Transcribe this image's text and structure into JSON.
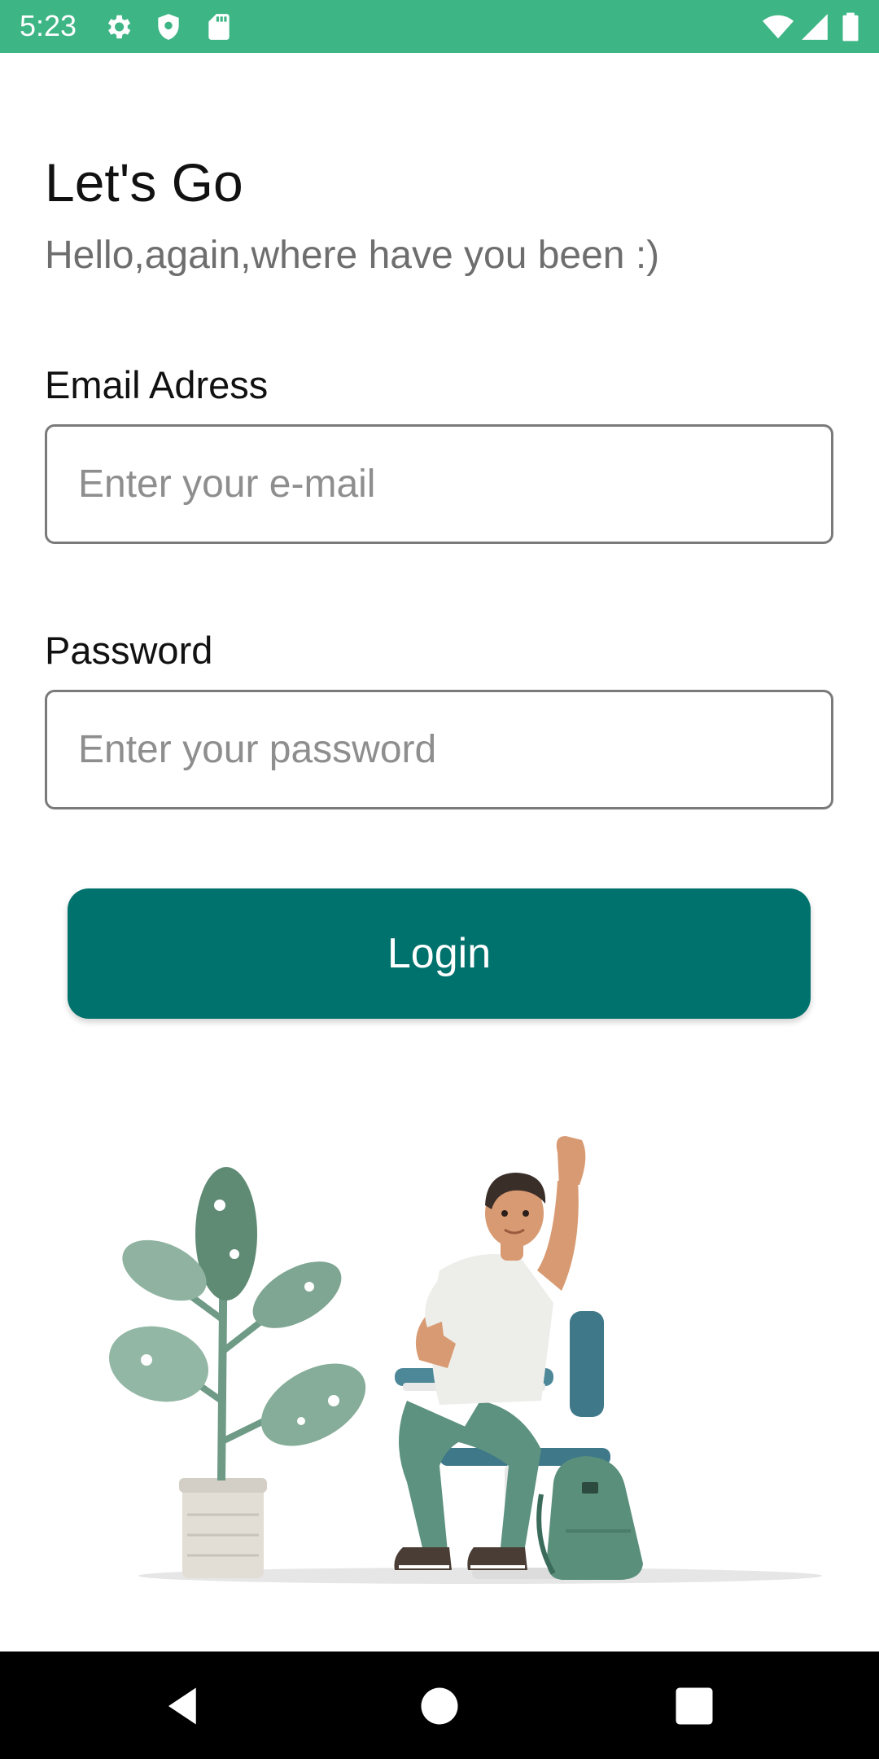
{
  "status_bar": {
    "time": "5:23",
    "background_color": "#3db585",
    "left_icons": [
      "gear-icon",
      "shield-icon",
      "sd-card-icon"
    ],
    "right_icons": [
      "wifi-icon",
      "signal-icon",
      "battery-icon"
    ]
  },
  "header": {
    "title": "Let's Go",
    "subtitle": "Hello,again,where have you been :)"
  },
  "form": {
    "email": {
      "label": "Email Adress",
      "placeholder": "Enter your e-mail",
      "value": ""
    },
    "password": {
      "label": "Password",
      "placeholder": "Enter your password",
      "value": ""
    },
    "login_label": "Login",
    "login_color": "#00726d"
  },
  "illustration": {
    "description_icon": "person-with-plant-illustration"
  },
  "nav_bar": {
    "buttons": [
      "back-icon",
      "home-icon",
      "recents-icon"
    ]
  }
}
